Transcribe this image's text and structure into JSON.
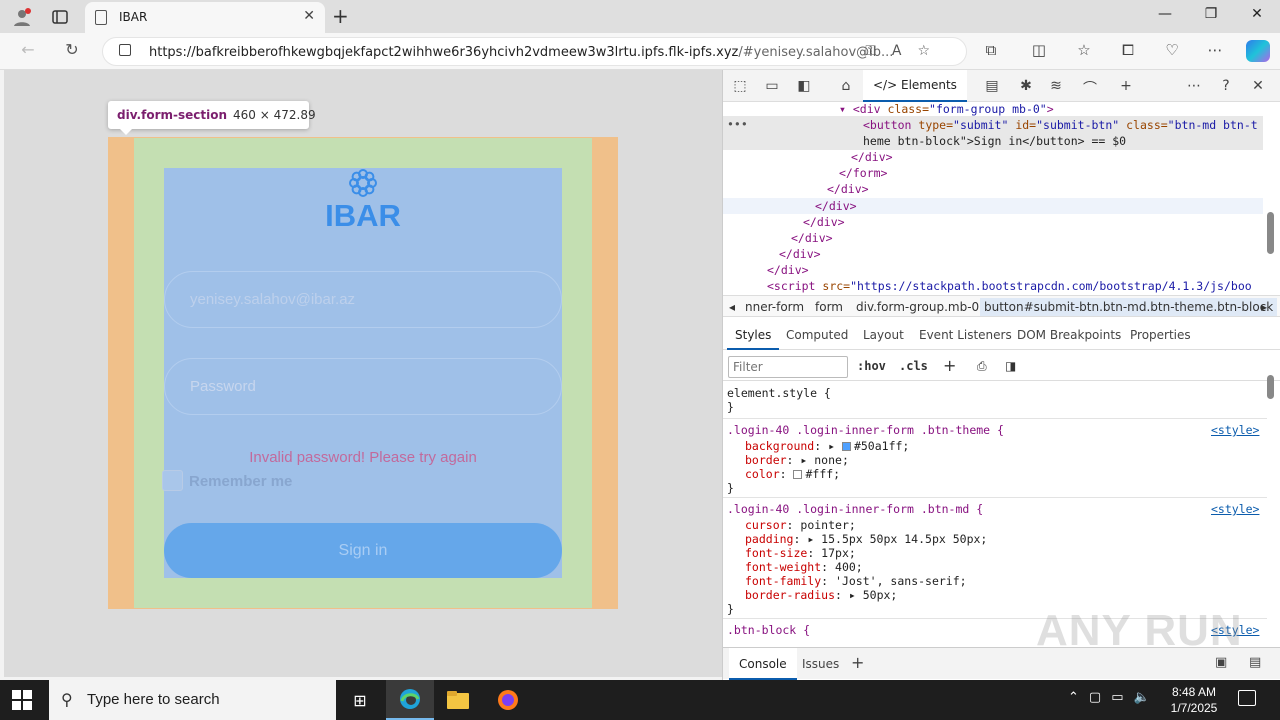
{
  "browser": {
    "tab_title": "IBAR",
    "url_main": "https://bafkreibberofhkewgbqjekfapct2wihhwe6r36yhcivh2vdmeew3w3lrtu.ipfs.flk-ipfs.xyz",
    "url_fragment": "/#yenisey.salahov@ib..."
  },
  "page": {
    "tooltip_selector": "div.form-section",
    "tooltip_dims": "460 × 472.89",
    "brand": "IBAR",
    "email_value": "yenisey.salahov@ibar.az",
    "password_placeholder": "Password",
    "error_text": "Invalid password! Please try again",
    "remember_label": "Remember me",
    "signin_label": "Sign in"
  },
  "devtools": {
    "elements_tab": "Elements",
    "dom_lines": [
      {
        "open": "<div ",
        "attr": "class=",
        "val": "\"form-group mb-0\"",
        "close": ">"
      },
      {
        "open": "<button ",
        "attr": "type=",
        "val": "\"submit\"",
        "attr2": " id=",
        "val2": "\"submit-btn\"",
        "attr3": " class=",
        "val3": "\"btn-md btn-t"
      },
      {
        "text": "heme btn-block\">Sign in</button> == $0"
      },
      {
        "tag": "</div>"
      },
      {
        "tag": "</form>"
      },
      {
        "tag": "</div>"
      },
      {
        "tag": "</div>"
      },
      {
        "tag": "</div>"
      },
      {
        "tag": "</div>"
      },
      {
        "tag": "</div>"
      },
      {
        "tag": "</div>"
      },
      {
        "open": "<script ",
        "attr": "src=",
        "val": "\"https://stackpath.bootstrapcdn.com/bootstrap/4.1.3/js/boo"
      }
    ],
    "breadcrumbs": [
      "nner-form",
      "form",
      "div.form-group.mb-0",
      "button#submit-btn.btn-md.btn-theme.btn-block"
    ],
    "style_tabs": [
      "Styles",
      "Computed",
      "Layout",
      "Event Listeners",
      "DOM Breakpoints",
      "Properties"
    ],
    "filter_placeholder": "Filter",
    "hov": ":hov",
    "cls": ".cls",
    "rules": {
      "element_style": "element.style {",
      "close": "}",
      "rule1_selector": ".login-40 .login-inner-form .btn-theme {",
      "rule1_src": "<style>",
      "rule1_props": [
        {
          "name": "background",
          "value": "#50a1ff;",
          "swatch": "#50a1ff"
        },
        {
          "name": "border",
          "value": "none;"
        },
        {
          "name": "color",
          "value": "#fff;",
          "swatch": "#ffffff"
        }
      ],
      "rule2_selector": ".login-40 .login-inner-form .btn-md {",
      "rule2_src": "<style>",
      "rule2_props": [
        {
          "name": "cursor",
          "value": "pointer;"
        },
        {
          "name": "padding",
          "value": "15.5px 50px 14.5px 50px;"
        },
        {
          "name": "font-size",
          "value": "17px;"
        },
        {
          "name": "font-weight",
          "value": "400;"
        },
        {
          "name": "font-family",
          "value": "'Jost', sans-serif;"
        },
        {
          "name": "border-radius",
          "value": "50px;"
        }
      ],
      "rule3_selector": ".btn-block {",
      "rule3_src": "<style>"
    },
    "drawer_console": "Console",
    "drawer_issues": "Issues"
  },
  "watermark": "ANY RUN",
  "taskbar": {
    "search_placeholder": "Type here to search",
    "time": "8:48 AM",
    "date": "1/7/2025"
  }
}
